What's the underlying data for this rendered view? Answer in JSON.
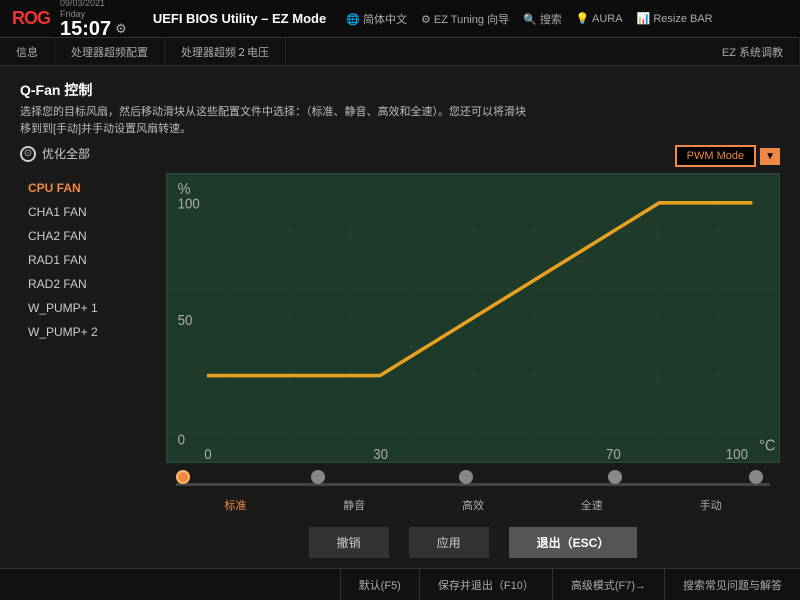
{
  "topbar": {
    "brand": "UEFI BIOS Utility – EZ Mode",
    "date": "09/03/2021\nFriday",
    "time": "15:07",
    "icons": [
      {
        "label": "简体中文",
        "icon": "🌐"
      },
      {
        "label": "EZ Tuning 向导",
        "icon": "⚙"
      },
      {
        "label": "搜索",
        "icon": "🔍"
      },
      {
        "label": "AURA",
        "icon": "💡"
      },
      {
        "label": "Resize BAR",
        "icon": "📊"
      }
    ]
  },
  "nav": {
    "tabs": [
      "信息",
      "处理器超频配置",
      "处理器超频２电压",
      "EZ 系统调教"
    ],
    "right": "EZ 系统调教"
  },
  "panel": {
    "title": "Q-Fan 控制",
    "description": "选择您的目标风扇，然后移动滑块从这些配置文件中选择：（标准、静音、高效和全速）。您还可以将滑块\n移到到[手动]并手动设置风扇转速。",
    "optimize_label": "优化全部",
    "fans": [
      {
        "label": "CPU FAN",
        "active": true
      },
      {
        "label": "CHA1 FAN",
        "active": false
      },
      {
        "label": "CHA2 FAN",
        "active": false
      },
      {
        "label": "RAD1 FAN",
        "active": false
      },
      {
        "label": "RAD2 FAN",
        "active": false
      },
      {
        "label": "W_PUMP+ 1",
        "active": false
      },
      {
        "label": "W_PUMP+ 2",
        "active": false
      }
    ],
    "pwm_label": "PWM Mode",
    "chart": {
      "x_label": "°C",
      "y_label": "%",
      "x_ticks": [
        "0",
        "30",
        "70",
        "100"
      ],
      "y_ticks": [
        "0",
        "50",
        "100"
      ]
    },
    "slider": {
      "points": [
        {
          "label": "标准",
          "active": true,
          "pct": 0
        },
        {
          "label": "静音",
          "active": false,
          "pct": 25
        },
        {
          "label": "高效",
          "active": false,
          "pct": 50
        },
        {
          "label": "全速",
          "active": false,
          "pct": 75
        },
        {
          "label": "手动",
          "active": false,
          "pct": 100
        }
      ]
    },
    "buttons": {
      "cancel": "撤销",
      "apply": "应用",
      "exit": "退出（ESC）"
    }
  },
  "bottombar": {
    "items": [
      {
        "label": "默认(F5)"
      },
      {
        "label": "保存并退出（F10）"
      },
      {
        "label": "高级模式(F7)→"
      },
      {
        "label": "搜索常见问题与解答"
      }
    ]
  }
}
